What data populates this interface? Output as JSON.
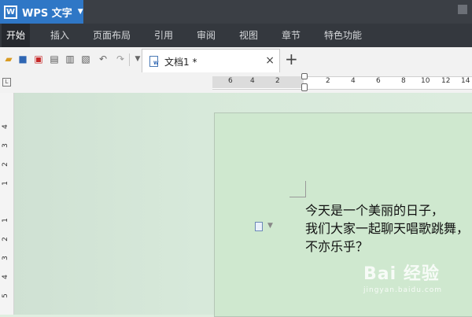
{
  "app": {
    "title": "WPS 文字"
  },
  "menu": {
    "items": [
      "开始",
      "插入",
      "页面布局",
      "引用",
      "审阅",
      "视图",
      "章节",
      "特色功能"
    ]
  },
  "toolbar": {
    "icons": [
      "open-icon",
      "save-icon",
      "export-pdf-icon",
      "print-icon",
      "print-preview-icon",
      "document-check-icon",
      "undo-icon",
      "redo-icon",
      "dropdown-icon"
    ]
  },
  "tab": {
    "label": "文档1 *",
    "close": "×",
    "new": "+"
  },
  "ruler": {
    "corner": "L",
    "horizontal_labels": [
      "6",
      "4",
      "2",
      "2",
      "4",
      "6",
      "8",
      "10",
      "12",
      "14"
    ],
    "vertical_labels": [
      "4",
      "3",
      "2",
      "1",
      "1",
      "2",
      "3",
      "4",
      "5"
    ]
  },
  "document": {
    "lines": [
      "今天是一个美丽的日子，",
      "我们大家一起聊天唱歌跳舞，",
      "不亦乐乎？"
    ]
  },
  "watermark": {
    "main": "Bai 经验",
    "sub": "jingyan.baidu.com"
  }
}
